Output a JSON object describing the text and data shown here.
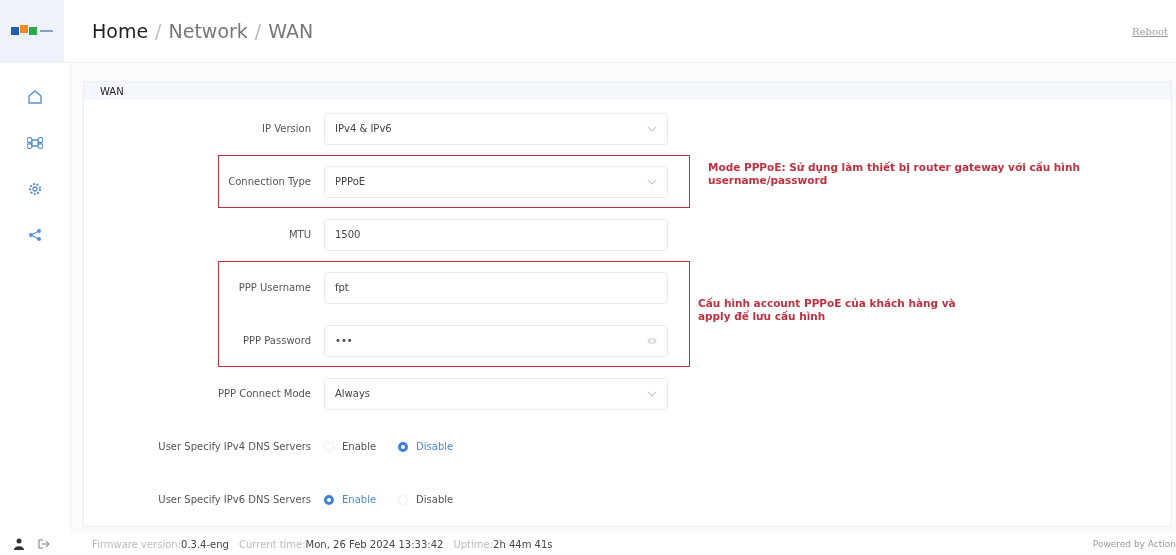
{
  "breadcrumb": {
    "items": [
      "Home",
      "Network",
      "WAN"
    ],
    "separator": "/"
  },
  "header_action": "Reboot",
  "card": {
    "title": "WAN",
    "groups": [
      {
        "highlighted": false,
        "rows": [
          {
            "label": "IP Version",
            "kind": "select",
            "value": "IPv4 & IPv6"
          }
        ]
      },
      {
        "highlighted": true,
        "note": "Mode PPPoE: Sử dụng làm thiết bị router gateway với cấu hình username/password",
        "rows": [
          {
            "label": "Connection Type",
            "kind": "select",
            "value": "PPPoE"
          }
        ]
      },
      {
        "highlighted": false,
        "rows": [
          {
            "label": "MTU",
            "kind": "input",
            "value": "1500"
          }
        ]
      },
      {
        "highlighted": true,
        "note": "Cấu hình account PPPoE của khách hàng và apply để lưu cấu hình",
        "rows": [
          {
            "label": "PPP Username",
            "kind": "input",
            "value": "fpt"
          },
          {
            "label": "PPP Password",
            "kind": "password",
            "value": "•••"
          }
        ]
      },
      {
        "highlighted": false,
        "rows": [
          {
            "label": "PPP Connect Mode",
            "kind": "select",
            "value": "Always"
          },
          {
            "label": "User Specify IPv4 DNS Servers",
            "kind": "radio",
            "options": [
              {
                "label": "Enable",
                "selected": false
              },
              {
                "label": "Disable",
                "selected": true
              }
            ]
          },
          {
            "label": "User Specify IPv6 DNS Servers",
            "kind": "radio",
            "options": [
              {
                "label": "Enable",
                "selected": true
              },
              {
                "label": "Disable",
                "selected": false
              }
            ]
          }
        ]
      }
    ]
  },
  "footer": {
    "info": [
      {
        "label": "Firmware version:",
        "value": "0.3.4-eng"
      },
      {
        "label": "Current time:",
        "value": "Mon, 26 Feb 2024 13:33:42"
      },
      {
        "label": "Uptime:",
        "value": "2h 44m 41s"
      }
    ],
    "powered": "Powered by Action"
  }
}
